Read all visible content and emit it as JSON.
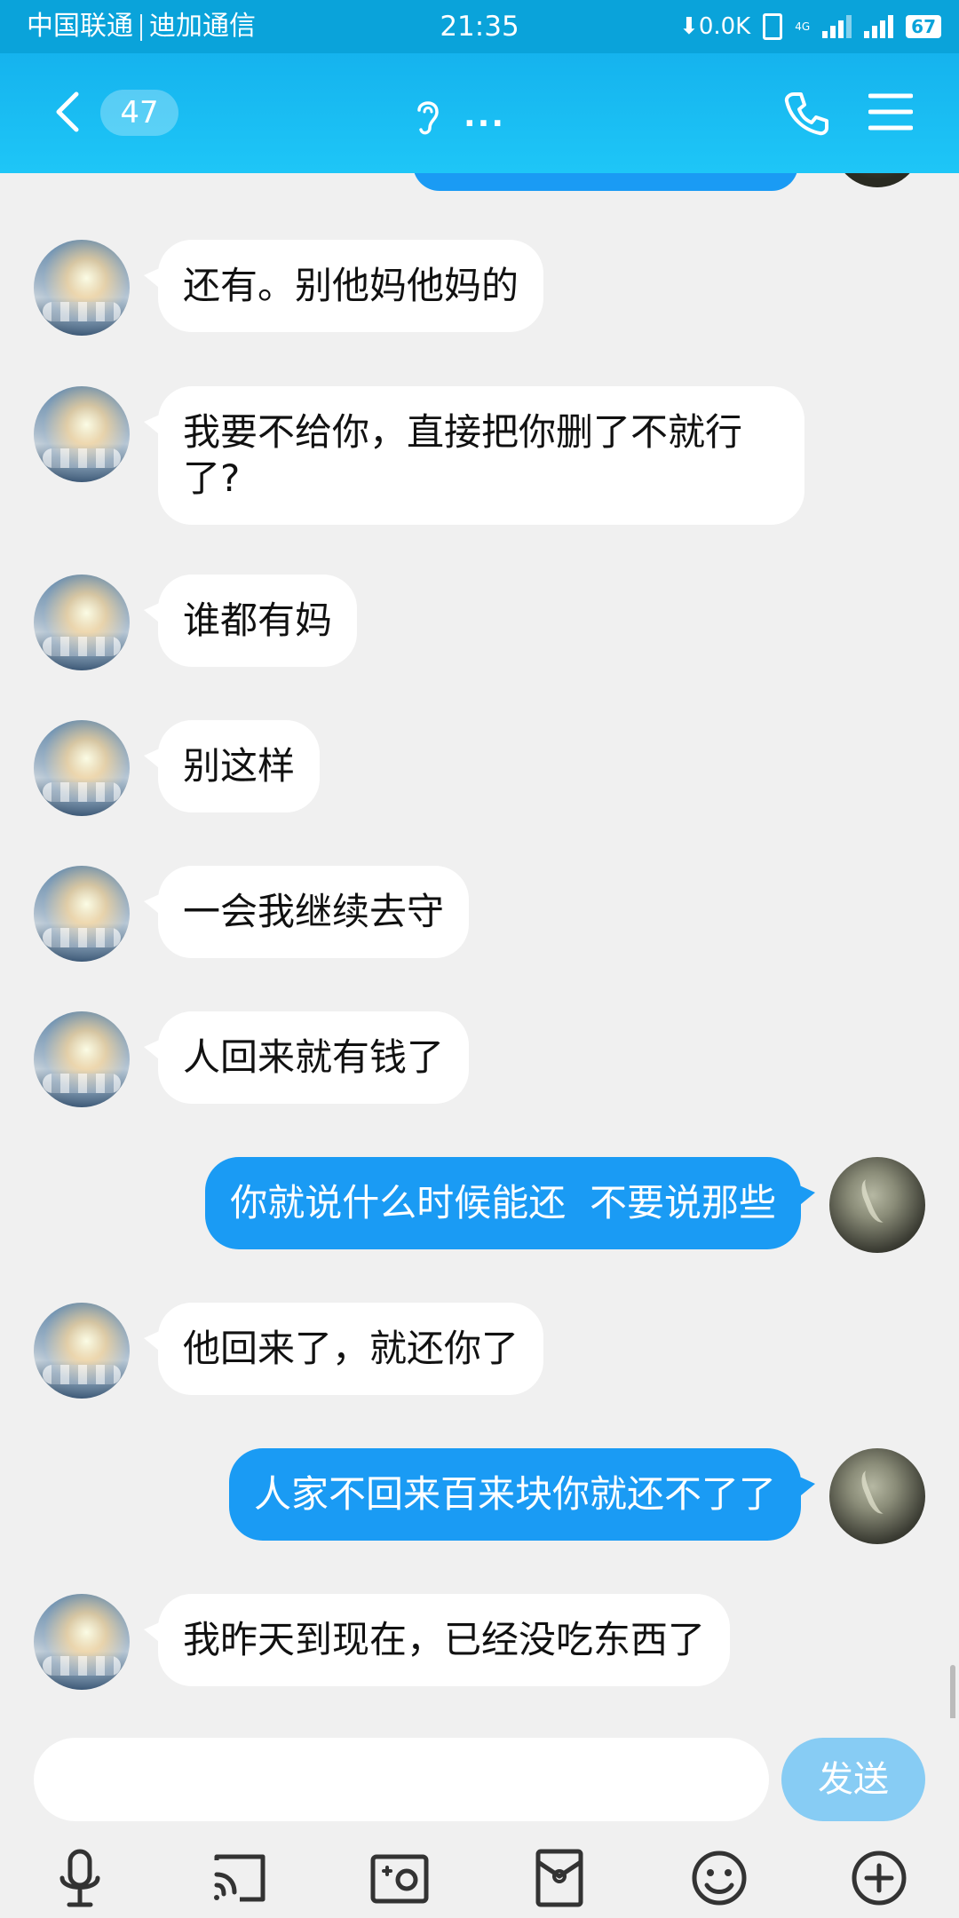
{
  "status_bar": {
    "carrier1": "中国联通",
    "carrier2": "迪加通信",
    "time": "21:35",
    "net_speed": "0.0K",
    "lte": "4G",
    "battery": "67"
  },
  "header": {
    "unread_count": "47",
    "title": "..."
  },
  "messages": [
    {
      "from": "other",
      "text": "还有。别他妈他妈的"
    },
    {
      "from": "other",
      "text": "我要不给你，直接把你删了不就行了?"
    },
    {
      "from": "other",
      "text": "谁都有妈"
    },
    {
      "from": "other",
      "text": "别这样"
    },
    {
      "from": "other",
      "text": "一会我继续去守"
    },
    {
      "from": "other",
      "text": "人回来就有钱了"
    },
    {
      "from": "me",
      "text": "你就说什么时候能还  不要说那些"
    },
    {
      "from": "other",
      "text": "他回来了，就还你了"
    },
    {
      "from": "me",
      "text": "人家不回来百来块你就还不了了"
    },
    {
      "from": "other",
      "text": "我昨天到现在，已经没吃东西了"
    }
  ],
  "input": {
    "value": "",
    "send_label": "发送"
  },
  "toolbar": [
    "microphone-icon",
    "screen-cast-icon",
    "photo-icon",
    "red-packet-icon",
    "emoji-icon",
    "plus-icon"
  ],
  "colors": {
    "header": "#15b3ee",
    "my_bubble": "#1a9bf4",
    "other_bubble": "#ffffff",
    "send_button": "#87ccf4"
  }
}
